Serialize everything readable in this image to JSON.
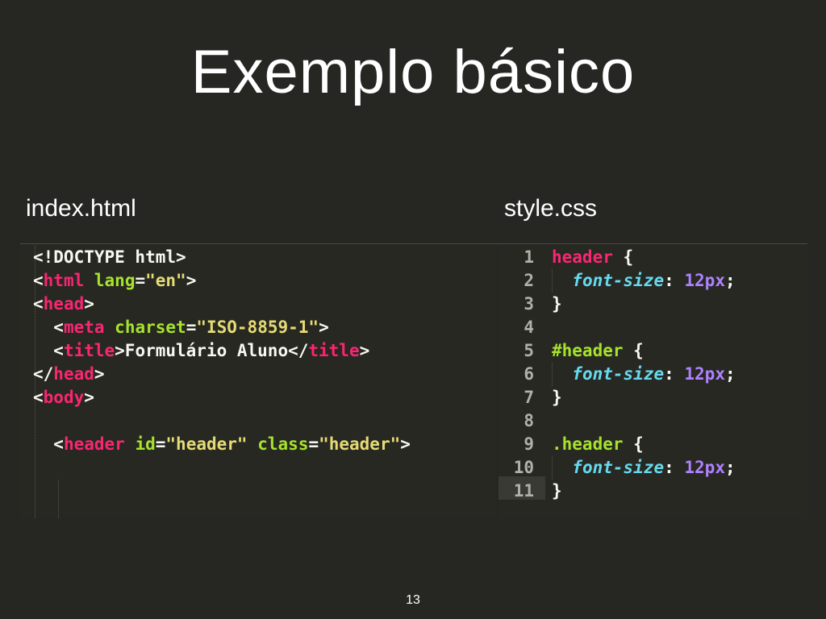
{
  "title": "Exemplo básico",
  "files": {
    "html_label": "index.html",
    "css_label": "style.css"
  },
  "html_code": {
    "lines": [
      {
        "tokens": [
          {
            "t": "<!DOCTYPE html>",
            "c": "plain"
          }
        ]
      },
      {
        "tokens": [
          {
            "t": "<",
            "c": "plain"
          },
          {
            "t": "html",
            "c": "tag"
          },
          {
            "t": " ",
            "c": "plain"
          },
          {
            "t": "lang",
            "c": "attr"
          },
          {
            "t": "=",
            "c": "plain"
          },
          {
            "t": "\"en\"",
            "c": "str"
          },
          {
            "t": ">",
            "c": "plain"
          }
        ]
      },
      {
        "tokens": [
          {
            "t": "<",
            "c": "plain"
          },
          {
            "t": "head",
            "c": "tag"
          },
          {
            "t": ">",
            "c": "plain"
          }
        ]
      },
      {
        "tokens": [
          {
            "t": "  <",
            "c": "plain"
          },
          {
            "t": "meta",
            "c": "tag"
          },
          {
            "t": " ",
            "c": "plain"
          },
          {
            "t": "charset",
            "c": "attr"
          },
          {
            "t": "=",
            "c": "plain"
          },
          {
            "t": "\"ISO-8859-1\"",
            "c": "str"
          },
          {
            "t": ">",
            "c": "plain"
          }
        ]
      },
      {
        "tokens": [
          {
            "t": "  <",
            "c": "plain"
          },
          {
            "t": "title",
            "c": "tag"
          },
          {
            "t": ">Formulário Aluno</",
            "c": "plain"
          },
          {
            "t": "title",
            "c": "tag"
          },
          {
            "t": ">",
            "c": "plain"
          }
        ]
      },
      {
        "tokens": [
          {
            "t": "</",
            "c": "plain"
          },
          {
            "t": "head",
            "c": "tag"
          },
          {
            "t": ">",
            "c": "plain"
          }
        ]
      },
      {
        "tokens": [
          {
            "t": "<",
            "c": "plain"
          },
          {
            "t": "body",
            "c": "tag"
          },
          {
            "t": ">",
            "c": "plain"
          }
        ]
      },
      {
        "tokens": []
      },
      {
        "tokens": [
          {
            "t": "  <",
            "c": "plain"
          },
          {
            "t": "header",
            "c": "tag"
          },
          {
            "t": " ",
            "c": "plain"
          },
          {
            "t": "id",
            "c": "attr"
          },
          {
            "t": "=",
            "c": "plain"
          },
          {
            "t": "\"header\"",
            "c": "str"
          },
          {
            "t": " ",
            "c": "plain"
          },
          {
            "t": "class",
            "c": "attr"
          },
          {
            "t": "=",
            "c": "plain"
          },
          {
            "t": "\"header\"",
            "c": "str"
          },
          {
            "t": ">",
            "c": "plain"
          }
        ]
      }
    ]
  },
  "css_code": {
    "active_line": 11,
    "lines": [
      {
        "num": "1",
        "tokens": [
          {
            "t": "header",
            "c": "tag"
          },
          {
            "t": " {",
            "c": "plain"
          }
        ]
      },
      {
        "num": "2",
        "tokens": [
          {
            "t": "  ",
            "c": "plain"
          },
          {
            "t": "font-size",
            "c": "prop"
          },
          {
            "t": ": ",
            "c": "plain"
          },
          {
            "t": "12px",
            "c": "num"
          },
          {
            "t": ";",
            "c": "plain"
          }
        ]
      },
      {
        "num": "3",
        "tokens": [
          {
            "t": "}",
            "c": "plain"
          }
        ]
      },
      {
        "num": "4",
        "tokens": []
      },
      {
        "num": "5",
        "tokens": [
          {
            "t": "#header",
            "c": "attr"
          },
          {
            "t": " {",
            "c": "plain"
          }
        ]
      },
      {
        "num": "6",
        "tokens": [
          {
            "t": "  ",
            "c": "plain"
          },
          {
            "t": "font-size",
            "c": "prop"
          },
          {
            "t": ": ",
            "c": "plain"
          },
          {
            "t": "12px",
            "c": "num"
          },
          {
            "t": ";",
            "c": "plain"
          }
        ]
      },
      {
        "num": "7",
        "tokens": [
          {
            "t": "}",
            "c": "plain"
          }
        ]
      },
      {
        "num": "8",
        "tokens": []
      },
      {
        "num": "9",
        "tokens": [
          {
            "t": ".header",
            "c": "attr"
          },
          {
            "t": " {",
            "c": "plain"
          }
        ]
      },
      {
        "num": "10",
        "tokens": [
          {
            "t": "  ",
            "c": "plain"
          },
          {
            "t": "font-size",
            "c": "prop"
          },
          {
            "t": ": ",
            "c": "plain"
          },
          {
            "t": "12px",
            "c": "num"
          },
          {
            "t": ";",
            "c": "plain"
          }
        ]
      },
      {
        "num": "11",
        "tokens": [
          {
            "t": "}",
            "c": "plain"
          }
        ]
      }
    ]
  },
  "page_number": "13",
  "colors": {
    "background": "#262622",
    "tag": "#f92672",
    "attribute": "#a6e22e",
    "string": "#e6db74",
    "property": "#66d9ef",
    "number": "#ae81ff"
  }
}
